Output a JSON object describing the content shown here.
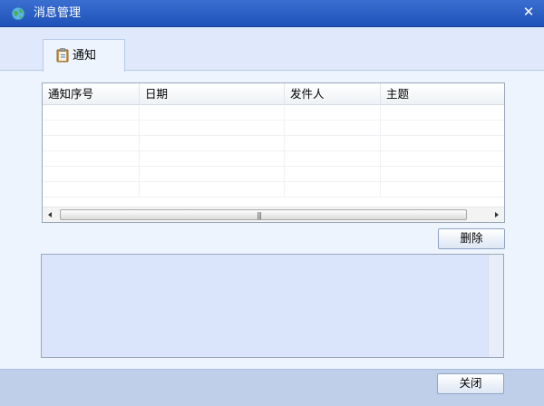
{
  "window": {
    "title": "消息管理",
    "close_glyph": "✕",
    "icon": "globe-icon"
  },
  "tabs": [
    {
      "label": "通知",
      "icon": "clipboard-icon",
      "selected": true
    }
  ],
  "grid": {
    "columns": [
      "通知序号",
      "日期",
      "发件人",
      "主题"
    ],
    "rows": []
  },
  "scrollbar": {
    "left_arrow": "◂",
    "right_arrow": "▸",
    "grip": "|||"
  },
  "buttons": {
    "delete": "删除",
    "close": "关闭"
  },
  "colors": {
    "titlebar": "#2a5fc7",
    "content_bg": "#eef4fe",
    "detail_bg": "#dae5fb",
    "footer_bg": "#bfcfea"
  }
}
